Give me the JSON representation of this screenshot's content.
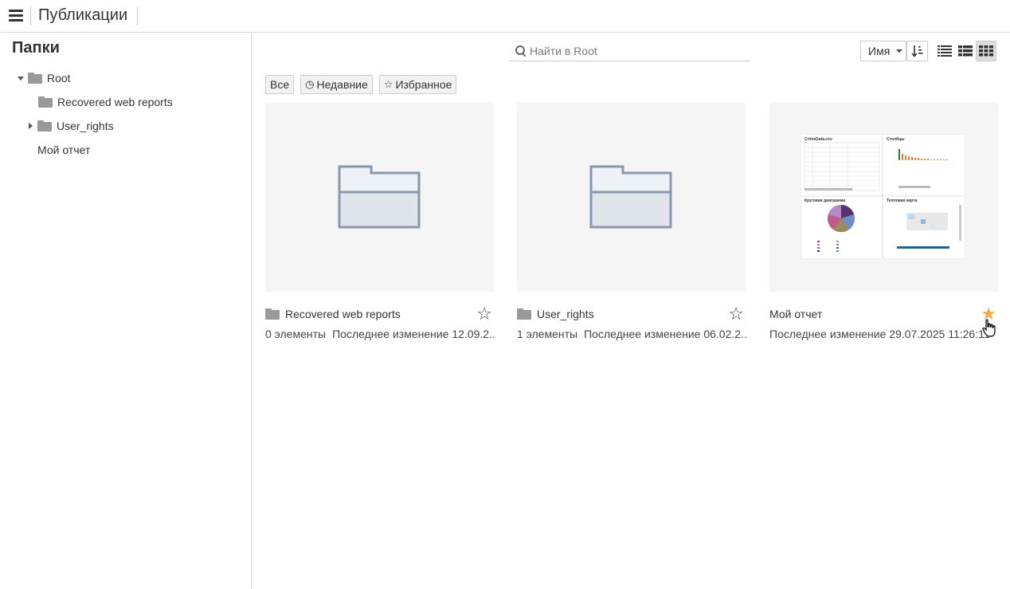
{
  "header": {
    "title": "Публикации"
  },
  "sidebar": {
    "title": "Папки",
    "tree": [
      {
        "label": "Root"
      },
      {
        "label": "Recovered web reports"
      },
      {
        "label": "User_rights"
      },
      {
        "label": "Мой отчет"
      }
    ]
  },
  "toolbar": {
    "search_placeholder": "Найти в Root",
    "sort_label": "Имя"
  },
  "filters": {
    "all": "Все",
    "recent": "Недавние",
    "favorites": "Избранное"
  },
  "cards": [
    {
      "title": "Recovered web reports",
      "count": "0 элементы",
      "modified": "Последнее изменение 12.09.2...",
      "starred": false
    },
    {
      "title": "User_rights",
      "count": "1 элементы",
      "modified": "Последнее изменение 06.02.2...",
      "starred": false
    },
    {
      "title": "Мой отчет",
      "count": "",
      "modified": "Последнее изменение 29.07.2025 11:26:11",
      "starred": true
    }
  ],
  "report_preview": {
    "panels": [
      "CrimeData.csv",
      "Столбцы",
      "Круговая диаграмма",
      "Тепловая карта"
    ]
  },
  "colors": {
    "star_active": "#f0ad4e",
    "folder": "#999999",
    "folder_large_stroke": "#8a98ad"
  }
}
